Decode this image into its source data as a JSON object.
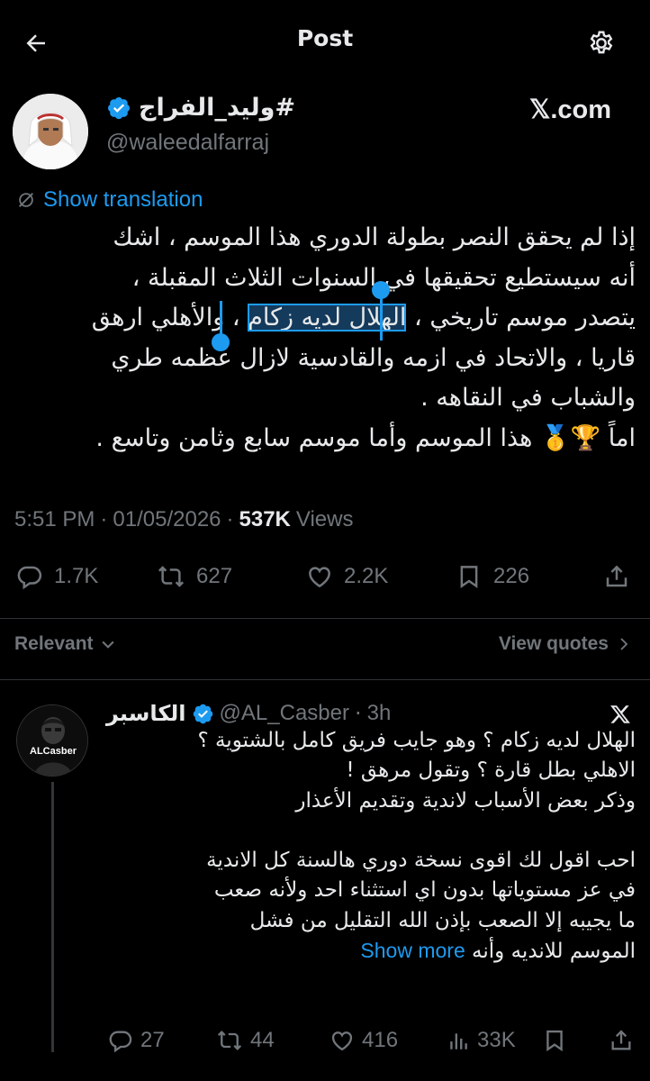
{
  "header": {
    "title": "Post"
  },
  "tweet": {
    "author_name": "#وليد_الفراج",
    "author_handle": "@waleedalfarraj",
    "source_label": "𝕏.com",
    "translate_label": "Show translation",
    "lines": [
      "إذا لم يحقق النصر بطولة الدوري هذا الموسم ، اشك",
      "أنه سيستطيع تحقيقها في السنوات الثلاث المقبلة ،",
      "قاريا ، والاتحاد في ازمه والقادسية لازال عظمه طري",
      "والشباب في النقاهه .",
      "اماً 🏆🥇 هذا الموسم وأما موسم سابع وثامن وتاسع ."
    ],
    "line3_before": "يتصدر موسم تاريخي ، ",
    "line3_selected": "الهلال لديه زكام",
    "line3_after": "، والأهلي ارهق",
    "time": "5:51 PM",
    "date": "01/05/2026",
    "views_count": "537K",
    "views_label": "Views",
    "dot": "·",
    "stats": {
      "replies": "1.7K",
      "reposts": "627",
      "likes": "2.2K",
      "bookmarks": "226"
    }
  },
  "filter": {
    "relevant_label": "Relevant",
    "view_quotes_label": "View quotes"
  },
  "reply": {
    "author_name": "الكاسبر",
    "author_handle": "@AL_Casber",
    "time": "3h",
    "avatar_text": "ALCasber",
    "lines": [
      "الهلال لديه زكام ؟ وهو جايب فريق كامل بالشتوية ؟",
      "الاهلي بطل قارة ؟ وتقول مرهق !",
      "وذكر بعض الأسباب لاندية وتقديم الأعذار",
      "",
      "احب اقول لك اقوى نسخة دوري هالسنة كل الاندية",
      "في عز مستوياتها بدون اي استثناء احد ولأنه صعب",
      "ما يجيبه إلا الصعب بإذن الله التقليل من فشل"
    ],
    "last_line": "الموسم للانديه وأنه",
    "show_more": "Show more",
    "stats": {
      "replies": "27",
      "reposts": "44",
      "likes": "416",
      "views": "33K"
    }
  },
  "colors": {
    "accent": "#1d9bf0",
    "background": "#000000",
    "text": "#e7e9ea",
    "muted": "#71767b",
    "divider": "#2f3336"
  },
  "icons": [
    "back-arrow-icon",
    "settings-icon",
    "verified-badge-icon",
    "translate-icon",
    "reply-icon",
    "repost-icon",
    "like-icon",
    "bookmark-icon",
    "share-icon",
    "chevron-down-icon",
    "chevron-right-icon",
    "x-logo-icon",
    "views-icon"
  ]
}
